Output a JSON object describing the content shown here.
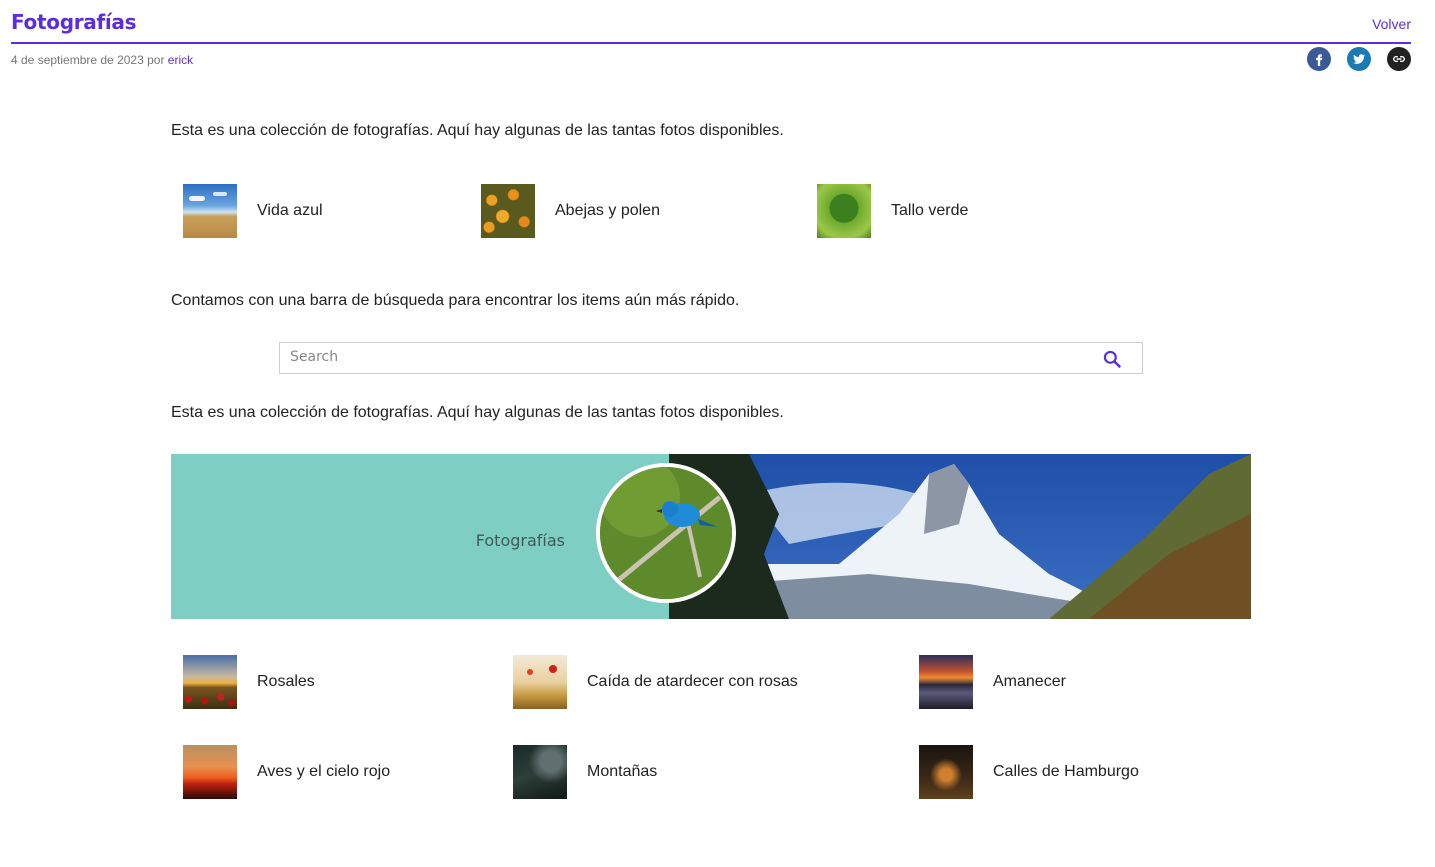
{
  "header": {
    "title": "Fotografías",
    "back_label": "Volver"
  },
  "meta": {
    "date_prefix": "4 de septiembre de 2023 por",
    "author": "erick"
  },
  "share": [
    {
      "name": "facebook-icon",
      "color": "#3b5998"
    },
    {
      "name": "twitter-icon",
      "color": "#1a7ab3"
    },
    {
      "name": "link-icon",
      "color": "#222222"
    }
  ],
  "intro_text": "Esta es una colección de fotografías. Aquí hay algunas de las tantas fotos disponibles.",
  "gallery_top": [
    {
      "label": "Vida azul"
    },
    {
      "label": "Abejas y polen"
    },
    {
      "label": "Tallo verde"
    }
  ],
  "search_text": "Contamos con una barra de búsqueda para encontrar los items aún más rápido.",
  "search": {
    "placeholder": "Search"
  },
  "intro_text_2": "Esta es una colección de fotografías. Aquí hay algunas de las tantas fotos disponibles.",
  "banner": {
    "title": "Fotografías"
  },
  "gallery_bottom": [
    {
      "label": "Rosales"
    },
    {
      "label": "Caída de atardecer con rosas"
    },
    {
      "label": "Amanecer"
    },
    {
      "label": "Aves y el cielo rojo"
    },
    {
      "label": "Montañas"
    },
    {
      "label": "Calles de Hamburgo"
    }
  ],
  "colors": {
    "accent": "#5b2de0",
    "banner_bg": "#7ecec4"
  }
}
